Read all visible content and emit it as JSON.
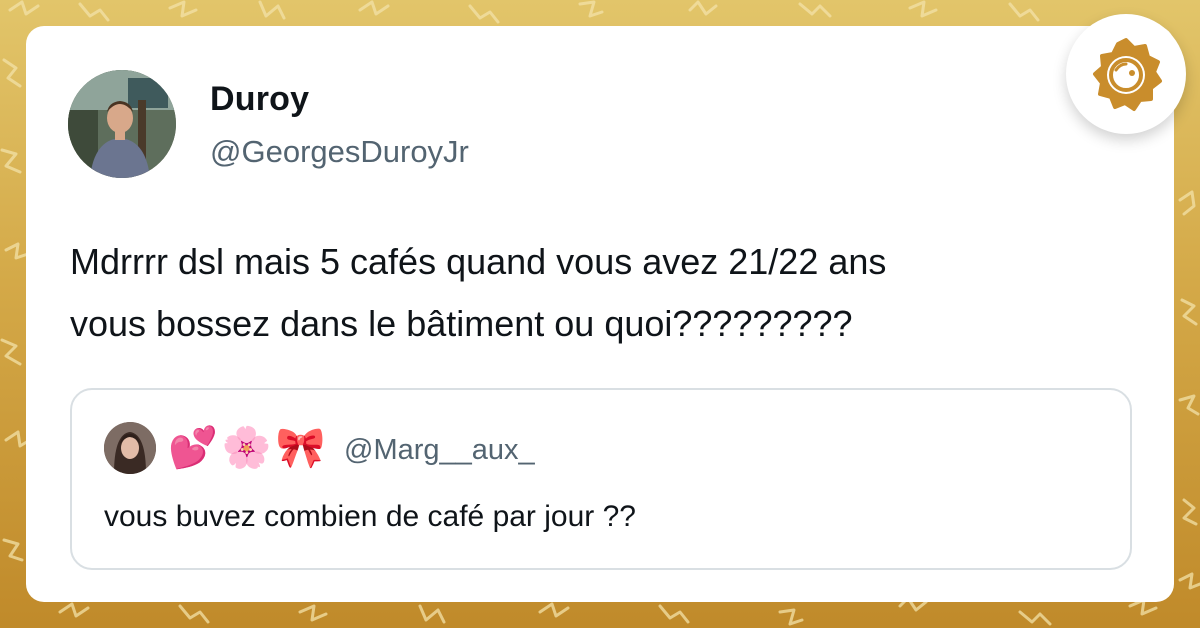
{
  "tweet": {
    "display_name": "Duroy",
    "handle": "@GeorgesDuroyJr",
    "text_line1": "Mdrrrr dsl mais 5 cafés quand vous avez 21/22 ans",
    "text_line2": "vous bossez dans le bâtiment ou quoi?????????"
  },
  "quoted_tweet": {
    "emoji_1": "💕",
    "emoji_2": "🌸",
    "emoji_3": "🎀",
    "handle": "@Marg__aux_",
    "text": "vous buvez combien de café par jour ??"
  },
  "icons": {
    "brand_logo": "sun-face-logo-icon",
    "avatar": "user-avatar",
    "quote_avatar": "quoted-user-avatar"
  },
  "colors": {
    "background_gold": "#d4a948",
    "text_primary": "#0f1419",
    "text_secondary": "#536471",
    "logo_gold": "#c98d2c"
  }
}
